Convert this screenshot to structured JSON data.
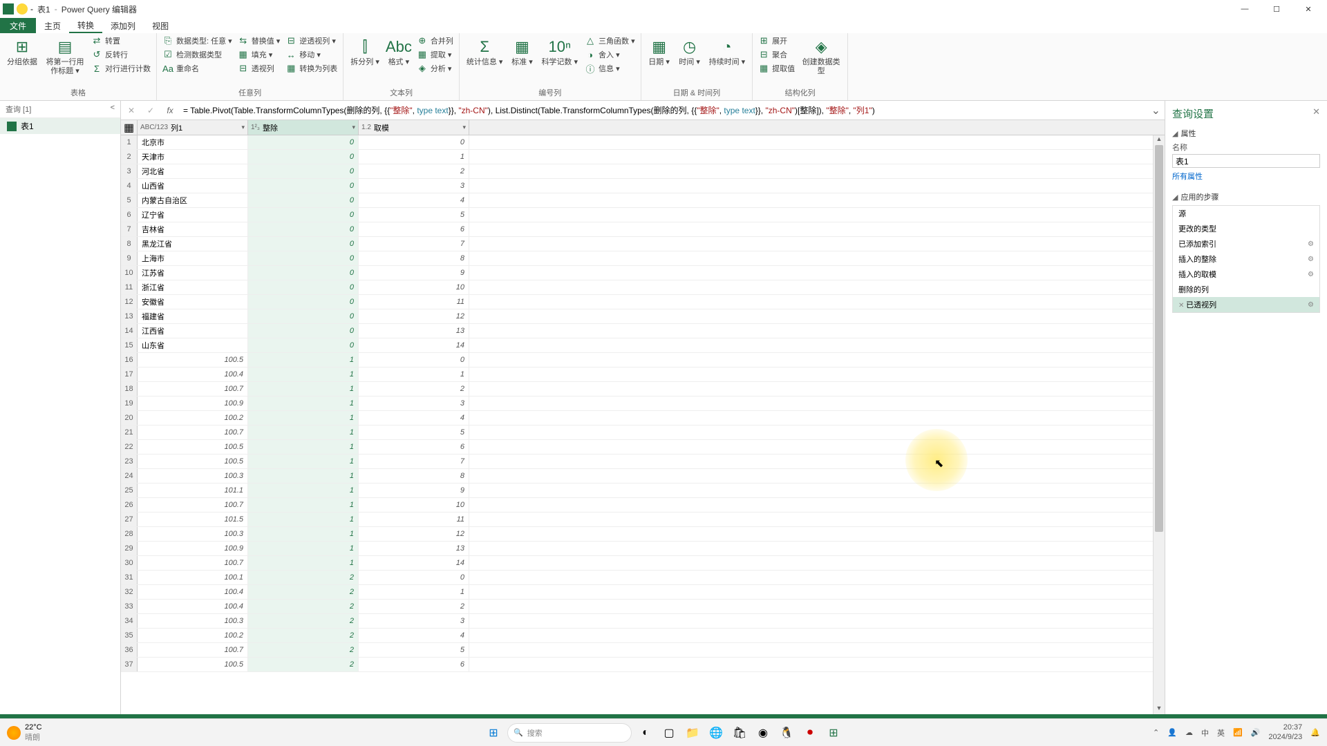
{
  "titlebar": {
    "doc_name": "表1",
    "app_name": "Power Query 编辑器",
    "separator": "-"
  },
  "win_buttons": {
    "min": "—",
    "max": "☐",
    "close": "✕"
  },
  "menu": {
    "file": "文件",
    "tabs": [
      "主页",
      "转换",
      "添加列",
      "视图"
    ],
    "active_index": 1
  },
  "ribbon": {
    "groups": [
      {
        "label": "表格",
        "items": [
          {
            "big": "分组依据",
            "icon": "⊞"
          },
          {
            "big": "将第一行用作标题",
            "icon": "▤",
            "dd": true
          },
          {
            "col": [
              {
                "icon": "⇄",
                "text": "转置"
              },
              {
                "icon": "↺",
                "text": "反转行"
              },
              {
                "icon": "Σ",
                "text": "对行进行计数"
              }
            ]
          }
        ]
      },
      {
        "label": "任意列",
        "items": [
          {
            "col": [
              {
                "icon": "⎘",
                "text": "数据类型: 任意 ▾"
              },
              {
                "icon": "☑",
                "text": "检测数据类型"
              },
              {
                "icon": "Aa",
                "text": "重命名"
              }
            ]
          },
          {
            "col": [
              {
                "icon": "⇆",
                "text": "替换值 ▾"
              },
              {
                "icon": "▦",
                "text": "填充 ▾"
              },
              {
                "icon": "⊟",
                "text": "透视列"
              }
            ]
          },
          {
            "col": [
              {
                "icon": "⊟",
                "text": "逆透视列 ▾"
              },
              {
                "icon": "↔",
                "text": "移动 ▾"
              },
              {
                "icon": "▦",
                "text": "转换为列表"
              }
            ]
          }
        ]
      },
      {
        "label": "文本列",
        "items": [
          {
            "big": "拆分列",
            "icon": "⫿",
            "dd": true
          },
          {
            "big": "格式",
            "icon": "Abc",
            "dd": true
          },
          {
            "col": [
              {
                "icon": "⊕",
                "text": "合并列"
              },
              {
                "icon": "▦",
                "text": "提取 ▾"
              },
              {
                "icon": "◈",
                "text": "分析 ▾"
              }
            ]
          }
        ]
      },
      {
        "label": "编号列",
        "items": [
          {
            "big": "统计信息",
            "icon": "Σ",
            "dd": true
          },
          {
            "big": "标准",
            "icon": "▦",
            "dd": true
          },
          {
            "big": "科学记数",
            "icon": "10ⁿ",
            "dd": true
          },
          {
            "col": [
              {
                "icon": "△",
                "text": "三角函数 ▾"
              },
              {
                "icon": "◑",
                "text": "舍入 ▾"
              },
              {
                "icon": "ⓘ",
                "text": "信息 ▾"
              }
            ]
          }
        ]
      },
      {
        "label": "日期 & 时间列",
        "items": [
          {
            "big": "日期",
            "icon": "▦",
            "dd": true
          },
          {
            "big": "时间",
            "icon": "◷",
            "dd": true
          },
          {
            "big": "持续时间",
            "icon": "◔",
            "dd": true
          }
        ]
      },
      {
        "label": "结构化列",
        "items": [
          {
            "col": [
              {
                "icon": "⊞",
                "text": "展开"
              },
              {
                "icon": "⊟",
                "text": "聚合"
              },
              {
                "icon": "▦",
                "text": "提取值"
              }
            ]
          },
          {
            "big": "创建数据类型",
            "icon": "◈"
          }
        ]
      }
    ]
  },
  "queries_pane": {
    "header": "查询 [1]",
    "collapse": "<",
    "items": [
      "表1"
    ]
  },
  "formula_bar": {
    "cancel": "✕",
    "confirm": "✓",
    "fx": "fx",
    "prefix": "= ",
    "text_parts": [
      {
        "t": "Table.Pivot(Table.TransformColumnTypes(删除的列, {{",
        "c": "kw"
      },
      {
        "t": "\"整除\"",
        "c": "str"
      },
      {
        "t": ", ",
        "c": "kw"
      },
      {
        "t": "type text",
        "c": "type"
      },
      {
        "t": "}}, ",
        "c": "kw"
      },
      {
        "t": "\"zh-CN\"",
        "c": "str"
      },
      {
        "t": "), List.Distinct(Table.TransformColumnTypes(删除的列, {{",
        "c": "kw"
      },
      {
        "t": "\"整除\"",
        "c": "str"
      },
      {
        "t": ", ",
        "c": "kw"
      },
      {
        "t": "type text",
        "c": "type"
      },
      {
        "t": "}}, ",
        "c": "kw"
      },
      {
        "t": "\"zh-CN\"",
        "c": "str"
      },
      {
        "t": ")[整除]), ",
        "c": "kw"
      },
      {
        "t": "\"整除\"",
        "c": "str"
      },
      {
        "t": ", ",
        "c": "kw"
      },
      {
        "t": "\"列1\"",
        "c": "str"
      },
      {
        "t": ")",
        "c": "kw"
      }
    ],
    "expand": "⌄"
  },
  "columns": [
    {
      "name": "列1",
      "type": "ABC/123",
      "w": "c1"
    },
    {
      "name": "整除",
      "type": "1²₃",
      "w": "c2",
      "selected": true
    },
    {
      "name": "取模",
      "type": "1.2",
      "w": "c3"
    }
  ],
  "rows": [
    {
      "c1": "北京市",
      "c2": "0",
      "c3": "0",
      "c1num": false
    },
    {
      "c1": "天津市",
      "c2": "0",
      "c3": "1",
      "c1num": false
    },
    {
      "c1": "河北省",
      "c2": "0",
      "c3": "2",
      "c1num": false
    },
    {
      "c1": "山西省",
      "c2": "0",
      "c3": "3",
      "c1num": false
    },
    {
      "c1": "内蒙古自治区",
      "c2": "0",
      "c3": "4",
      "c1num": false
    },
    {
      "c1": "辽宁省",
      "c2": "0",
      "c3": "5",
      "c1num": false
    },
    {
      "c1": "吉林省",
      "c2": "0",
      "c3": "6",
      "c1num": false
    },
    {
      "c1": "黑龙江省",
      "c2": "0",
      "c3": "7",
      "c1num": false
    },
    {
      "c1": "上海市",
      "c2": "0",
      "c3": "8",
      "c1num": false
    },
    {
      "c1": "江苏省",
      "c2": "0",
      "c3": "9",
      "c1num": false
    },
    {
      "c1": "浙江省",
      "c2": "0",
      "c3": "10",
      "c1num": false
    },
    {
      "c1": "安徽省",
      "c2": "0",
      "c3": "11",
      "c1num": false
    },
    {
      "c1": "福建省",
      "c2": "0",
      "c3": "12",
      "c1num": false
    },
    {
      "c1": "江西省",
      "c2": "0",
      "c3": "13",
      "c1num": false
    },
    {
      "c1": "山东省",
      "c2": "0",
      "c3": "14",
      "c1num": false
    },
    {
      "c1": "100.5",
      "c2": "1",
      "c3": "0",
      "c1num": true
    },
    {
      "c1": "100.4",
      "c2": "1",
      "c3": "1",
      "c1num": true
    },
    {
      "c1": "100.7",
      "c2": "1",
      "c3": "2",
      "c1num": true
    },
    {
      "c1": "100.9",
      "c2": "1",
      "c3": "3",
      "c1num": true
    },
    {
      "c1": "100.2",
      "c2": "1",
      "c3": "4",
      "c1num": true
    },
    {
      "c1": "100.7",
      "c2": "1",
      "c3": "5",
      "c1num": true
    },
    {
      "c1": "100.5",
      "c2": "1",
      "c3": "6",
      "c1num": true
    },
    {
      "c1": "100.5",
      "c2": "1",
      "c3": "7",
      "c1num": true
    },
    {
      "c1": "100.3",
      "c2": "1",
      "c3": "8",
      "c1num": true
    },
    {
      "c1": "101.1",
      "c2": "1",
      "c3": "9",
      "c1num": true
    },
    {
      "c1": "100.7",
      "c2": "1",
      "c3": "10",
      "c1num": true
    },
    {
      "c1": "101.5",
      "c2": "1",
      "c3": "11",
      "c1num": true
    },
    {
      "c1": "100.3",
      "c2": "1",
      "c3": "12",
      "c1num": true
    },
    {
      "c1": "100.9",
      "c2": "1",
      "c3": "13",
      "c1num": true
    },
    {
      "c1": "100.7",
      "c2": "1",
      "c3": "14",
      "c1num": true
    },
    {
      "c1": "100.1",
      "c2": "2",
      "c3": "0",
      "c1num": true
    },
    {
      "c1": "100.4",
      "c2": "2",
      "c3": "1",
      "c1num": true
    },
    {
      "c1": "100.4",
      "c2": "2",
      "c3": "2",
      "c1num": true
    },
    {
      "c1": "100.3",
      "c2": "2",
      "c3": "3",
      "c1num": true
    },
    {
      "c1": "100.2",
      "c2": "2",
      "c3": "4",
      "c1num": true
    },
    {
      "c1": "100.7",
      "c2": "2",
      "c3": "5",
      "c1num": true
    },
    {
      "c1": "100.5",
      "c2": "2",
      "c3": "6",
      "c1num": true
    }
  ],
  "settings": {
    "title": "查询设置",
    "close": "✕",
    "properties_label": "属性",
    "name_label": "名称",
    "name_value": "表1",
    "all_props": "所有属性",
    "steps_label": "应用的步骤",
    "steps": [
      {
        "name": "源",
        "gear": false,
        "del": false
      },
      {
        "name": "更改的类型",
        "gear": false,
        "del": false
      },
      {
        "name": "已添加索引",
        "gear": true,
        "del": false
      },
      {
        "name": "插入的整除",
        "gear": true,
        "del": false
      },
      {
        "name": "插入的取模",
        "gear": true,
        "del": false
      },
      {
        "name": "删除的列",
        "gear": false,
        "del": false
      },
      {
        "name": "已透视列",
        "gear": true,
        "del": true,
        "active": true
      }
    ]
  },
  "taskbar": {
    "weather_temp": "22°C",
    "weather_desc": "晴朗",
    "search_placeholder": "搜索",
    "tray": {
      "ime1": "中",
      "ime2": "英",
      "time": "20:37",
      "date": "2024/9/23"
    }
  }
}
